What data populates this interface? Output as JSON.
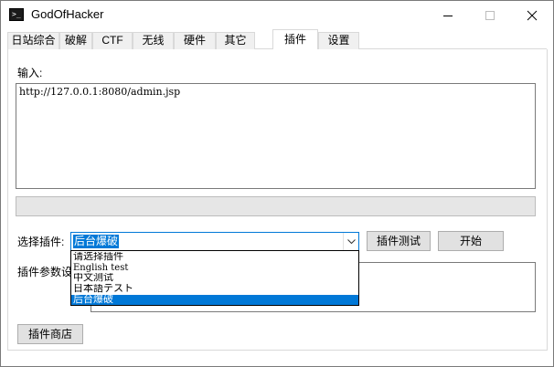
{
  "window": {
    "title": "GodOfHacker",
    "icon_name": "terminal-icon",
    "icon_glyph": ">_",
    "controls": [
      "minimize-icon",
      "maximize-icon",
      "close-icon"
    ]
  },
  "tabs": [
    {
      "label": "日站综合",
      "active": false
    },
    {
      "label": "破解",
      "active": false
    },
    {
      "label": "CTF",
      "active": false
    },
    {
      "label": "无线",
      "active": false
    },
    {
      "label": "硬件",
      "active": false
    },
    {
      "label": "其它",
      "active": false
    },
    {
      "label": "插件",
      "active": true
    },
    {
      "label": "设置",
      "active": false
    }
  ],
  "input": {
    "label": "输入:",
    "value": "http://127.0.0.1:8080/admin.jsp"
  },
  "progress": {
    "value": 0
  },
  "plugin_select": {
    "label": "选择插件:",
    "selected": "后台爆破",
    "options": [
      "请选择插件",
      "English test",
      "中文测试",
      "日本語テスト",
      "后台爆破"
    ],
    "open": true
  },
  "buttons": {
    "test_plugin": "插件测试",
    "start": "开始",
    "plugin_store": "插件商店"
  },
  "plugin_params": {
    "label": "插件参数设"
  },
  "colors": {
    "accent": "#0078d7",
    "button_bg": "#e1e1e1",
    "progress_track": "#e6e6e6"
  }
}
